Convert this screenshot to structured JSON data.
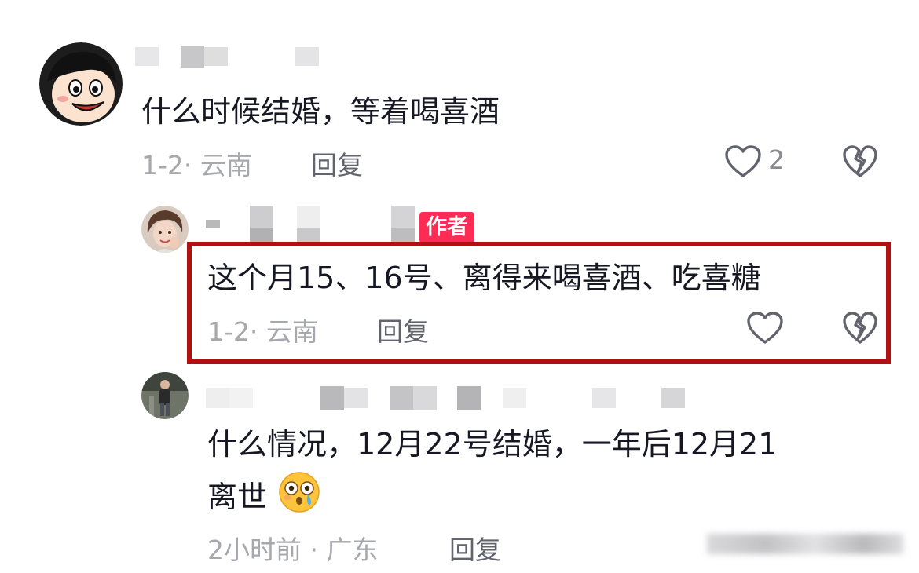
{
  "comments": [
    {
      "text": "什么时候结婚，等着喝喜酒",
      "time_location": "1-2· 云南",
      "reply_label": "回复",
      "like_count": "2"
    },
    {
      "badge": "作者",
      "text": "这个月15、16号、离得来喝喜酒、吃喜糖",
      "time_location": "1-2· 云南",
      "reply_label": "回复",
      "highlighted": true
    },
    {
      "text_line1": "什么情况，12月22号结婚，一年后12月21",
      "text_line2": "离世",
      "emoji": "😳💧",
      "time_location": "2小时前 · 广东",
      "reply_label": "回复"
    }
  ],
  "icons": {
    "like": "heart-outline-icon",
    "dislike": "broken-heart-icon"
  },
  "colors": {
    "author_badge": "#fe2c55",
    "highlight_border": "#b01010",
    "meta_text": "#a7a8ad"
  }
}
